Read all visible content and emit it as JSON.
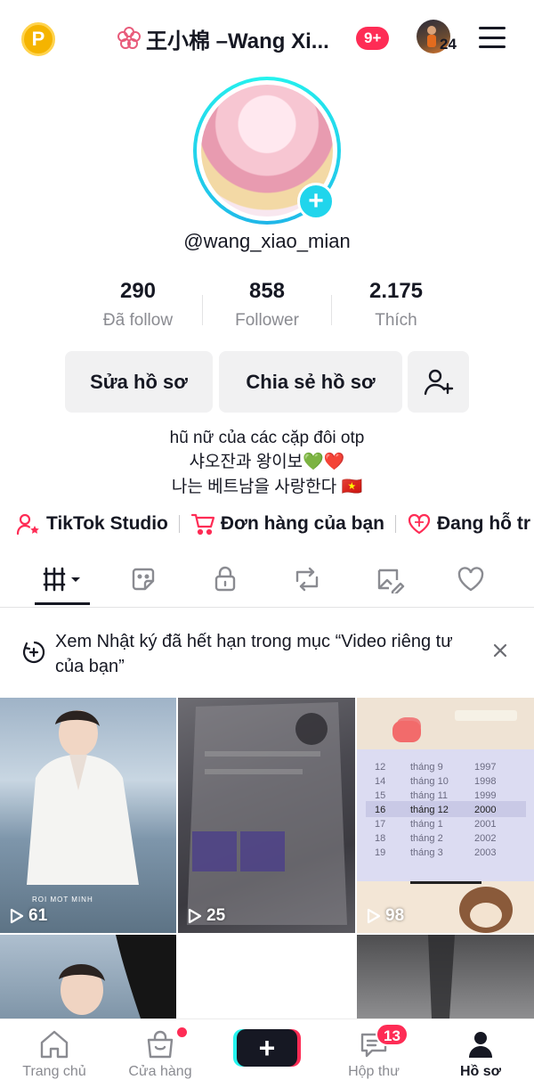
{
  "header": {
    "coin_label": "P",
    "title": "王小棉 –Wang Xi...",
    "notification_badge": "9+",
    "avatar_count": "24"
  },
  "profile": {
    "username": "@wang_xiao_mian"
  },
  "stats": [
    {
      "value": "290",
      "label": "Đã follow"
    },
    {
      "value": "858",
      "label": "Follower"
    },
    {
      "value": "2.175",
      "label": "Thích"
    }
  ],
  "buttons": {
    "edit": "Sửa hồ sơ",
    "share": "Chia sẻ hồ sơ"
  },
  "bio": [
    "hũ nữ của các cặp đôi otp",
    "샤오잔과 왕이보💚❤️",
    "나는 베트남을 사랑한다 🇻🇳"
  ],
  "links": [
    {
      "label": "TikTok Studio",
      "icon": "person-star-icon"
    },
    {
      "label": "Đơn hàng của bạn",
      "icon": "cart-icon"
    },
    {
      "label": "Đang hỗ tr",
      "icon": "heart-support-icon"
    }
  ],
  "tabs": [
    "videos-grid-icon",
    "sticker-icon",
    "lock-icon",
    "repost-icon",
    "tagged-icon",
    "heart-icon"
  ],
  "notice": {
    "text": "Xem Nhật ký đã hết hạn trong mục “Video riêng tư của bạn”"
  },
  "videos": [
    {
      "views": "61",
      "overlay": "ROI MOT MINH"
    },
    {
      "views": "25"
    },
    {
      "views": "98",
      "picker": {
        "rows": [
          [
            "12",
            "tháng 9",
            "1997"
          ],
          [
            "14",
            "tháng 10",
            "1998"
          ],
          [
            "15",
            "tháng 11",
            "1999"
          ],
          [
            "16",
            "tháng 12",
            "2000"
          ],
          [
            "17",
            "tháng 1",
            "2001"
          ],
          [
            "18",
            "tháng 2",
            "2002"
          ],
          [
            "19",
            "tháng 3",
            "2003"
          ]
        ]
      }
    }
  ],
  "nav": {
    "home": "Trang chủ",
    "shop": "Cửa hàng",
    "create": "+",
    "inbox": "Hộp thư",
    "inbox_badge": "13",
    "profile": "Hồ sơ"
  },
  "colors": {
    "accent": "#fe2c55",
    "cyan": "#25f4ee",
    "text": "#161823",
    "muted": "#8a8b91"
  }
}
